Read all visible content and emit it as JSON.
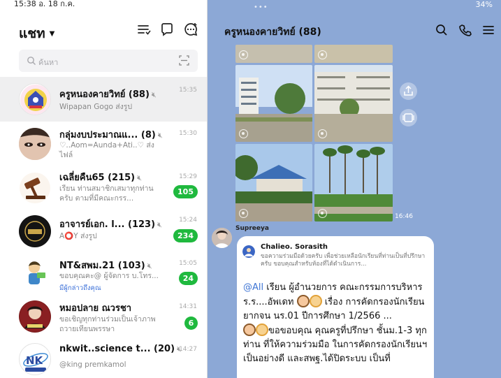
{
  "status_bar": {
    "time_date": "15:38  อ. 18 ก.ค.",
    "right": "34%"
  },
  "left": {
    "title": "แชท",
    "search": {
      "placeholder": "ค้นหา"
    },
    "chats": [
      {
        "name": "ครูหนองคายวิทย์ (88)",
        "preview": "Wipapan Gogo ส่งรูป",
        "time": "15:35",
        "muted": true,
        "selected": true
      },
      {
        "name": "กลุ่มงบประมาณแ...  (8)",
        "preview": "♡..Aom=Aunda+Ati..♡ ส่งไฟล์",
        "time": "15:30",
        "muted": true
      },
      {
        "name": "เฉลี่ยคืน65 (215)",
        "preview": "เรียน ท่านสมาชิกเสมาทุกท่านครับ     ตามที่มีคณะกรร...",
        "time": "15:29",
        "muted": true,
        "badge": "105"
      },
      {
        "name": "อาจารย์เอก. l... (123)",
        "preview": "A⭕Y ส่งรูป",
        "time": "15:24",
        "muted": true,
        "badge": "234"
      },
      {
        "name": "NT&สพม.21 (103)",
        "preview": "ขอบคุณคะ@ ผู้จัดการ บ.โทร...",
        "mention": "มีผู้กล่าวถึงคุณ",
        "time": "15:05",
        "muted": true,
        "badge": "24"
      },
      {
        "name": "หมอปลาย ณวรชา",
        "preview": "ขอเชิญทุกท่านร่วมเป็นเจ้าภาพถวายเทียนพรรษา",
        "time": "14:31",
        "badge": "6"
      },
      {
        "name": "nkwit..science t... (20)",
        "preview": "@king premkamol",
        "time": "14:27",
        "muted": true
      }
    ]
  },
  "right": {
    "title": "ครูหนองคายวิทย์ (88)",
    "photo_time": "16:46",
    "sender": "Supreeya",
    "reply_name": "Chalieo. Sorasith",
    "reply_text": "ขอความร่วมมือด้วยครับ เพื่อช่วยเหลือนักเรียนที่ท่านเป็นที่ปรึกษาครับ ขอบคุณสำหรับห้องที่ได้ดำเนินการ...",
    "msg_tag": "@All",
    "msg_line1": " เรียน ผู้อำนวยการ คณะกรรมการบริหารร.ร....อัพเดท",
    "msg_line2": " เรื่อง การคัดกรองนักเรียนยากจน นร.01 ปีการศึกษา 1/2566  ...",
    "msg_line3": "ขอขอบคุณ คุณครูที่ปรึกษา ชั้นม.1-3 ทุกท่าน ที่ให้ความร่วมมือ ในการคัดกรองนักเรียนฯ เป็นอย่างดี และสพฐ.ได้ปิดระบบ เป็นที่"
  },
  "colors": {
    "badge": "#1fb93e",
    "room_bg": "#8ca8d6",
    "mention": "#3a6fd8"
  }
}
